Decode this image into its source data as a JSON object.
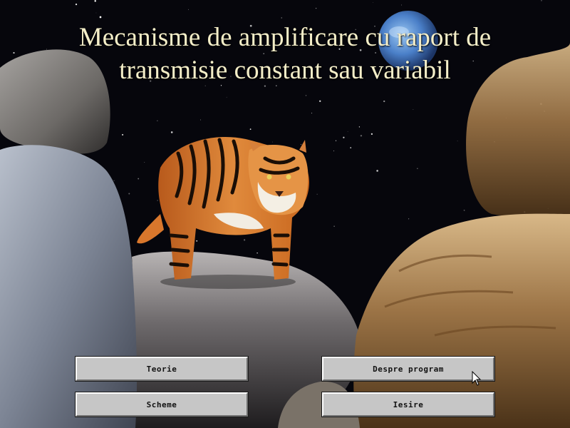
{
  "title": {
    "line1": "Mecanisme de amplificare cu raport de",
    "line2": "transmisie constant sau variabil"
  },
  "buttons": {
    "teorie": "Teorie",
    "despre": "Despre program",
    "scheme": "Scheme",
    "iesire": "Iesire"
  },
  "background": {
    "description_icon": "tiger-on-rocks-space-scene",
    "sky_color": "#06060c",
    "planet_color": "#4a7fc8"
  }
}
